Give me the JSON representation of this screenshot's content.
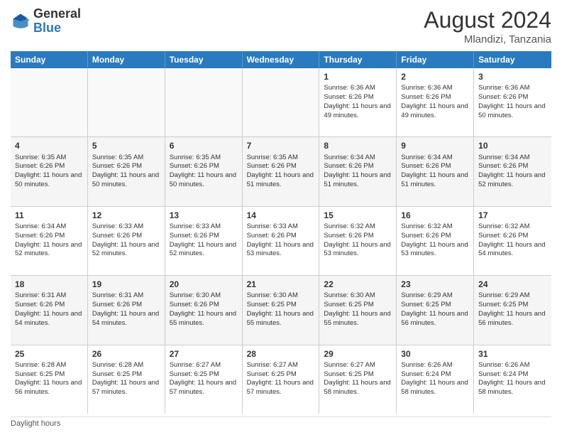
{
  "header": {
    "month_year": "August 2024",
    "location": "Mlandizi, Tanzania"
  },
  "logo": {
    "general": "General",
    "blue": "Blue"
  },
  "days": [
    "Sunday",
    "Monday",
    "Tuesday",
    "Wednesday",
    "Thursday",
    "Friday",
    "Saturday"
  ],
  "weeks": [
    [
      {
        "day": "",
        "info": ""
      },
      {
        "day": "",
        "info": ""
      },
      {
        "day": "",
        "info": ""
      },
      {
        "day": "",
        "info": ""
      },
      {
        "day": "1",
        "info": "Sunrise: 6:36 AM\nSunset: 6:26 PM\nDaylight: 11 hours and 49 minutes."
      },
      {
        "day": "2",
        "info": "Sunrise: 6:36 AM\nSunset: 6:26 PM\nDaylight: 11 hours and 49 minutes."
      },
      {
        "day": "3",
        "info": "Sunrise: 6:36 AM\nSunset: 6:26 PM\nDaylight: 11 hours and 50 minutes."
      }
    ],
    [
      {
        "day": "4",
        "info": "Sunrise: 6:35 AM\nSunset: 6:26 PM\nDaylight: 11 hours and 50 minutes."
      },
      {
        "day": "5",
        "info": "Sunrise: 6:35 AM\nSunset: 6:26 PM\nDaylight: 11 hours and 50 minutes."
      },
      {
        "day": "6",
        "info": "Sunrise: 6:35 AM\nSunset: 6:26 PM\nDaylight: 11 hours and 50 minutes."
      },
      {
        "day": "7",
        "info": "Sunrise: 6:35 AM\nSunset: 6:26 PM\nDaylight: 11 hours and 51 minutes."
      },
      {
        "day": "8",
        "info": "Sunrise: 6:34 AM\nSunset: 6:26 PM\nDaylight: 11 hours and 51 minutes."
      },
      {
        "day": "9",
        "info": "Sunrise: 6:34 AM\nSunset: 6:26 PM\nDaylight: 11 hours and 51 minutes."
      },
      {
        "day": "10",
        "info": "Sunrise: 6:34 AM\nSunset: 6:26 PM\nDaylight: 11 hours and 52 minutes."
      }
    ],
    [
      {
        "day": "11",
        "info": "Sunrise: 6:34 AM\nSunset: 6:26 PM\nDaylight: 11 hours and 52 minutes."
      },
      {
        "day": "12",
        "info": "Sunrise: 6:33 AM\nSunset: 6:26 PM\nDaylight: 11 hours and 52 minutes."
      },
      {
        "day": "13",
        "info": "Sunrise: 6:33 AM\nSunset: 6:26 PM\nDaylight: 11 hours and 52 minutes."
      },
      {
        "day": "14",
        "info": "Sunrise: 6:33 AM\nSunset: 6:26 PM\nDaylight: 11 hours and 53 minutes."
      },
      {
        "day": "15",
        "info": "Sunrise: 6:32 AM\nSunset: 6:26 PM\nDaylight: 11 hours and 53 minutes."
      },
      {
        "day": "16",
        "info": "Sunrise: 6:32 AM\nSunset: 6:26 PM\nDaylight: 11 hours and 53 minutes."
      },
      {
        "day": "17",
        "info": "Sunrise: 6:32 AM\nSunset: 6:26 PM\nDaylight: 11 hours and 54 minutes."
      }
    ],
    [
      {
        "day": "18",
        "info": "Sunrise: 6:31 AM\nSunset: 6:26 PM\nDaylight: 11 hours and 54 minutes."
      },
      {
        "day": "19",
        "info": "Sunrise: 6:31 AM\nSunset: 6:26 PM\nDaylight: 11 hours and 54 minutes."
      },
      {
        "day": "20",
        "info": "Sunrise: 6:30 AM\nSunset: 6:26 PM\nDaylight: 11 hours and 55 minutes."
      },
      {
        "day": "21",
        "info": "Sunrise: 6:30 AM\nSunset: 6:25 PM\nDaylight: 11 hours and 55 minutes."
      },
      {
        "day": "22",
        "info": "Sunrise: 6:30 AM\nSunset: 6:25 PM\nDaylight: 11 hours and 55 minutes."
      },
      {
        "day": "23",
        "info": "Sunrise: 6:29 AM\nSunset: 6:25 PM\nDaylight: 11 hours and 56 minutes."
      },
      {
        "day": "24",
        "info": "Sunrise: 6:29 AM\nSunset: 6:25 PM\nDaylight: 11 hours and 56 minutes."
      }
    ],
    [
      {
        "day": "25",
        "info": "Sunrise: 6:28 AM\nSunset: 6:25 PM\nDaylight: 11 hours and 56 minutes."
      },
      {
        "day": "26",
        "info": "Sunrise: 6:28 AM\nSunset: 6:25 PM\nDaylight: 11 hours and 57 minutes."
      },
      {
        "day": "27",
        "info": "Sunrise: 6:27 AM\nSunset: 6:25 PM\nDaylight: 11 hours and 57 minutes."
      },
      {
        "day": "28",
        "info": "Sunrise: 6:27 AM\nSunset: 6:25 PM\nDaylight: 11 hours and 57 minutes."
      },
      {
        "day": "29",
        "info": "Sunrise: 6:27 AM\nSunset: 6:25 PM\nDaylight: 11 hours and 58 minutes."
      },
      {
        "day": "30",
        "info": "Sunrise: 6:26 AM\nSunset: 6:24 PM\nDaylight: 11 hours and 58 minutes."
      },
      {
        "day": "31",
        "info": "Sunrise: 6:26 AM\nSunset: 6:24 PM\nDaylight: 11 hours and 58 minutes."
      }
    ]
  ],
  "footer": {
    "note": "Daylight hours"
  }
}
